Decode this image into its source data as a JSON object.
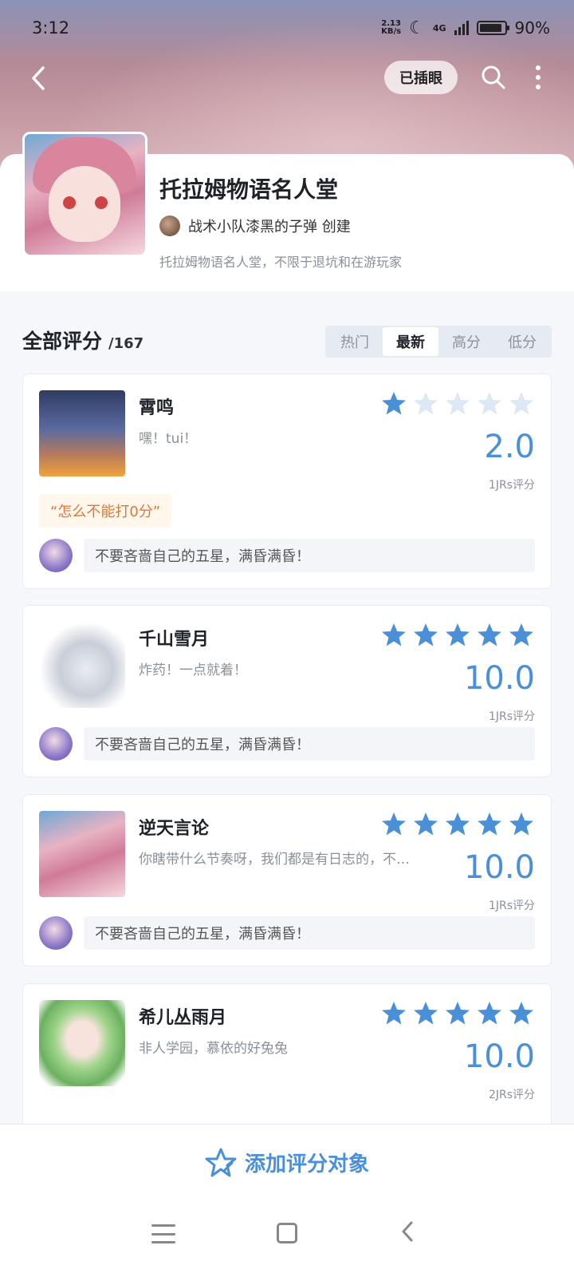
{
  "status_bar": {
    "time": "3:12",
    "net_speed_value": "2.13",
    "net_speed_unit": "KB/s",
    "network": "4G",
    "battery": "90%",
    "battery_level": 0.9
  },
  "top_bar": {
    "pin_button_label": "已插眼"
  },
  "group": {
    "title": "托拉姆物语名人堂",
    "creator": "战术小队漆黑的子弹 创建",
    "description": "托拉姆物语名人堂，不限于退坑和在游玩家"
  },
  "ratings": {
    "section_title": "全部评分",
    "count": "/167",
    "tabs": [
      {
        "label": "热门",
        "active": false
      },
      {
        "label": "最新",
        "active": true
      },
      {
        "label": "高分",
        "active": false
      },
      {
        "label": "低分",
        "active": false
      }
    ],
    "items": [
      {
        "name": "霄鸣",
        "subtitle": "嘿！tui！",
        "stars_filled": 1,
        "score": "2.0",
        "jrs": "1JRs评分",
        "quote": "“怎么不能打0分”",
        "comment": "不要吝啬自己的五星，满昏满昏！"
      },
      {
        "name": "千山雪月",
        "subtitle": "炸药！一点就着！",
        "stars_filled": 5,
        "score": "10.0",
        "jrs": "1JRs评分",
        "comment": "不要吝啬自己的五星，满昏满昏！"
      },
      {
        "name": "逆天言论",
        "subtitle": "你瞎带什么节奏呀，我们都是有日志的，不…",
        "stars_filled": 5,
        "score": "10.0",
        "jrs": "1JRs评分",
        "comment": "不要吝啬自己的五星，满昏满昏！"
      },
      {
        "name": "希儿丛雨月",
        "subtitle": "非人学园，慕依的好兔兔",
        "stars_filled": 5,
        "score": "10.0",
        "jrs": "2JRs评分"
      }
    ]
  },
  "bottom_action": {
    "label": "添加评分对象"
  },
  "colors": {
    "accent": "#4a90d9",
    "star_filled": "#4a90d9",
    "star_empty": "#dde8f5",
    "quote_text": "#d97a3b"
  }
}
